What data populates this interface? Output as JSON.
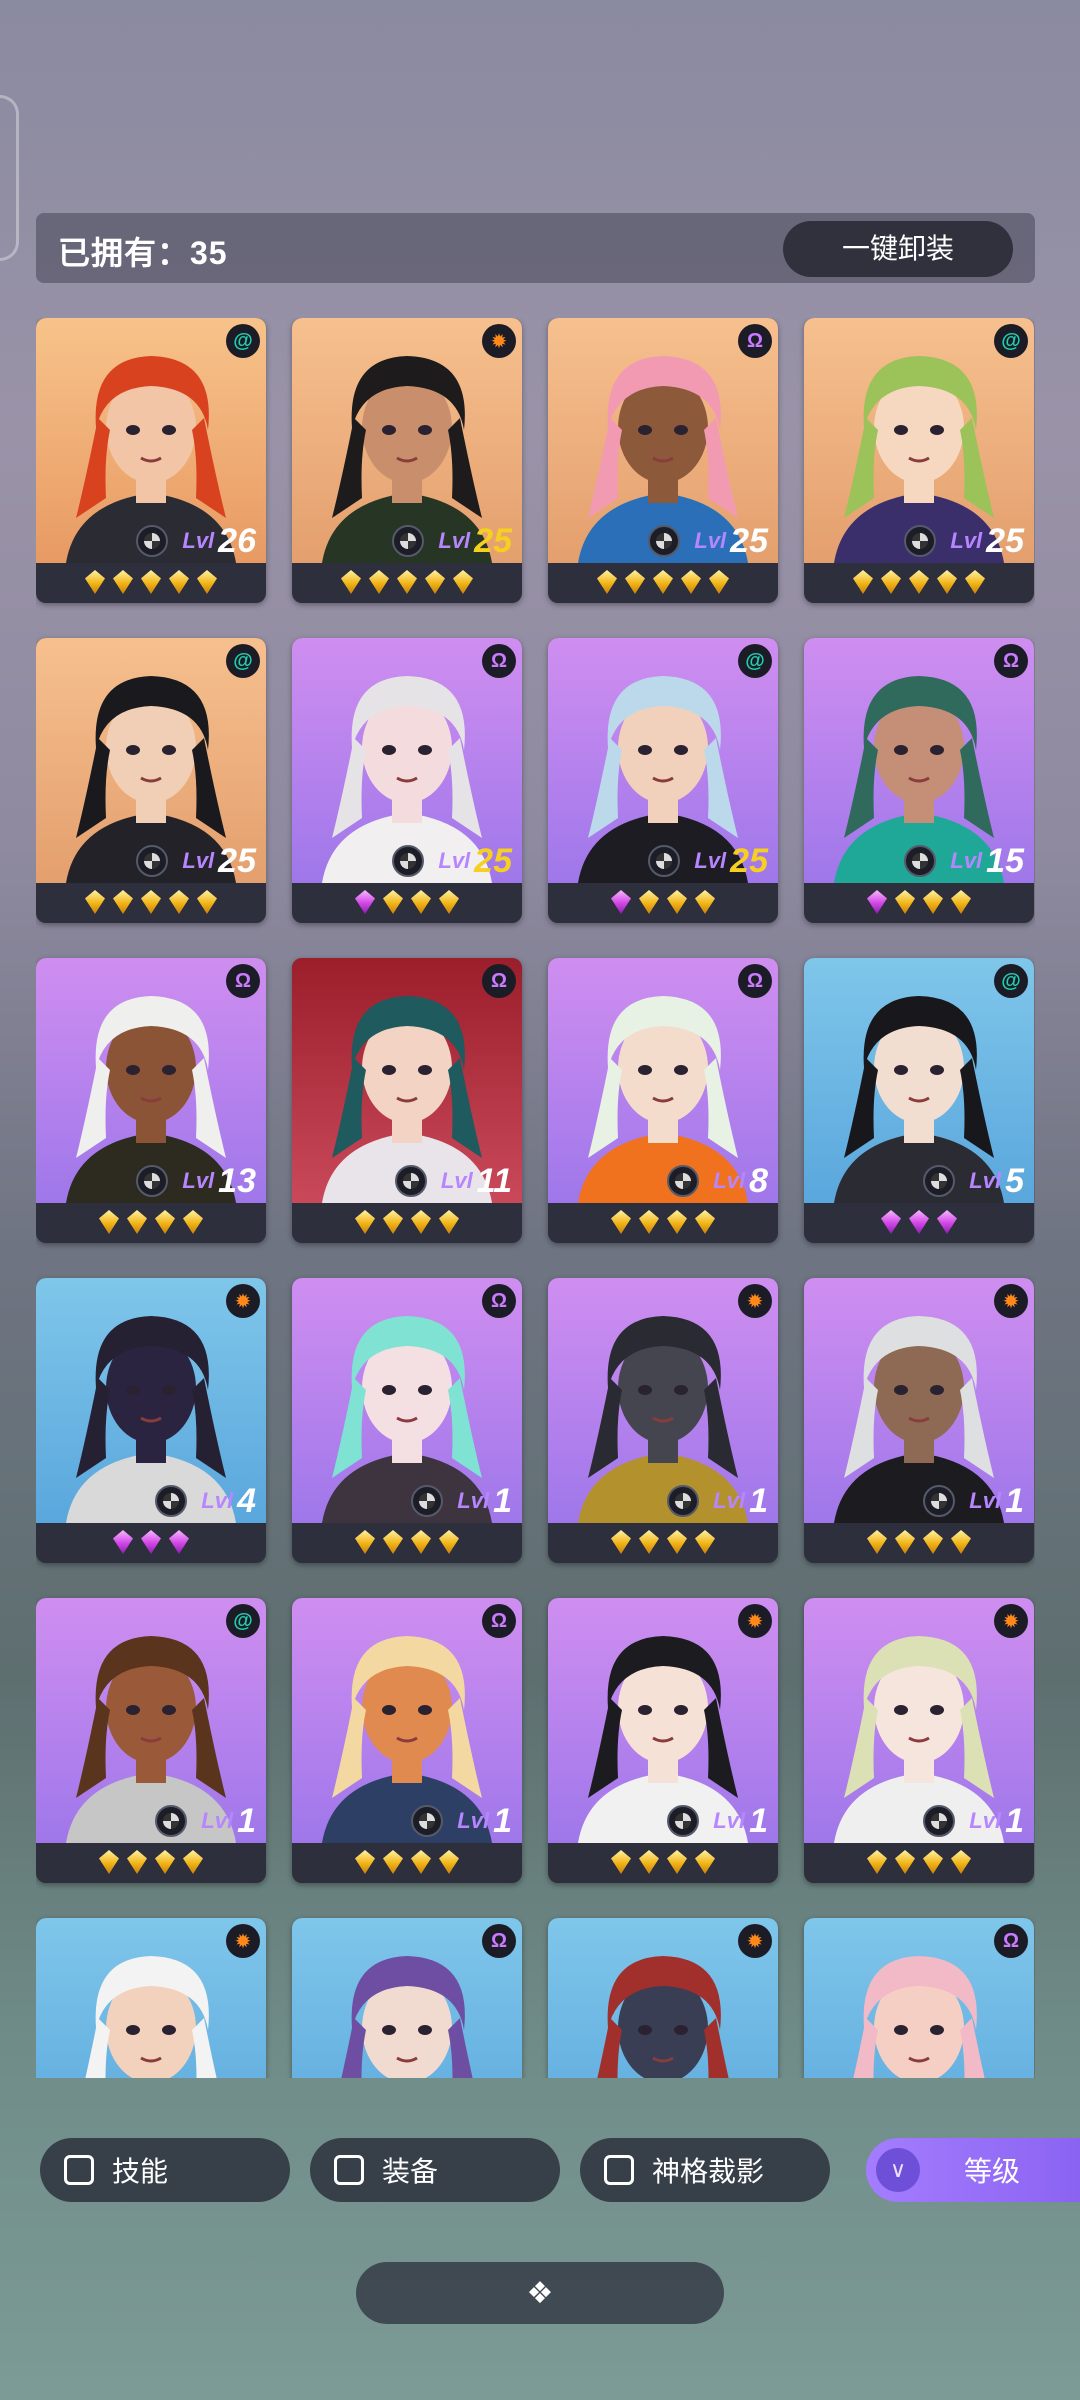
{
  "header": {
    "owned_label": "已拥有：35",
    "unequip_all": "一键卸装"
  },
  "cards": [
    {
      "lvl": "Lvl",
      "level": "26",
      "gold": false,
      "faction": "swirl-icon",
      "gems": [
        "gold",
        "gold",
        "gold",
        "gold",
        "gold"
      ],
      "colors": {
        "bg1": "#f7c38a",
        "bg2": "#e89a63",
        "hair": "#d8421f",
        "skin": "#f1c5a6",
        "cloth": "#2b2b33"
      }
    },
    {
      "lvl": "Lvl",
      "level": "25",
      "gold": true,
      "faction": "gear-icon",
      "gems": [
        "gold",
        "gold",
        "gold",
        "gold",
        "gold"
      ],
      "colors": {
        "bg1": "#f6c08e",
        "bg2": "#e49f6e",
        "hair": "#1e1b1c",
        "skin": "#c98f6c",
        "cloth": "#273525"
      }
    },
    {
      "lvl": "Lvl",
      "level": "25",
      "gold": false,
      "faction": "omega-icon",
      "gems": [
        "gold",
        "gold",
        "gold",
        "gold",
        "gold"
      ],
      "colors": {
        "bg1": "#f6c08e",
        "bg2": "#e49f6e",
        "hair": "#f29ab2",
        "skin": "#8c5a3b",
        "cloth": "#2a6fb8"
      }
    },
    {
      "lvl": "Lvl",
      "level": "25",
      "gold": false,
      "faction": "swirl-icon",
      "gems": [
        "gold",
        "gold",
        "gold",
        "gold",
        "gold"
      ],
      "colors": {
        "bg1": "#f6c08e",
        "bg2": "#e49f6e",
        "hair": "#9cc25a",
        "skin": "#f6d8c0",
        "cloth": "#3b2f6b"
      }
    },
    {
      "lvl": "Lvl",
      "level": "25",
      "gold": false,
      "faction": "swirl-icon",
      "gems": [
        "gold",
        "gold",
        "gold",
        "gold",
        "gold"
      ],
      "colors": {
        "bg1": "#f6c08e",
        "bg2": "#e49f6e",
        "hair": "#1a1a1e",
        "skin": "#f0cfb6",
        "cloth": "#222228"
      }
    },
    {
      "lvl": "Lvl",
      "level": "25",
      "gold": true,
      "faction": "omega-icon",
      "gems": [
        "purple",
        "gold",
        "gold",
        "gold"
      ],
      "colors": {
        "bg1": "#cf8ef0",
        "bg2": "#9f77ea",
        "hair": "#e6e3e6",
        "skin": "#f4dbdd",
        "cloth": "#f1efef"
      }
    },
    {
      "lvl": "Lvl",
      "level": "25",
      "gold": true,
      "faction": "swirl-icon",
      "gems": [
        "purple",
        "gold",
        "gold",
        "gold"
      ],
      "colors": {
        "bg1": "#cf8ef0",
        "bg2": "#9f77ea",
        "hair": "#bcd9ec",
        "skin": "#f1d0bc",
        "cloth": "#1c1c22"
      }
    },
    {
      "lvl": "Lvl",
      "level": "15",
      "gold": false,
      "faction": "omega-icon",
      "gems": [
        "purple",
        "gold",
        "gold",
        "gold"
      ],
      "colors": {
        "bg1": "#cf8ef0",
        "bg2": "#9f77ea",
        "hair": "#2f6a5c",
        "skin": "#c48e77",
        "cloth": "#1fa897"
      }
    },
    {
      "lvl": "Lvl",
      "level": "13",
      "gold": false,
      "faction": "omega-icon",
      "gems": [
        "gold",
        "gold",
        "gold",
        "gold"
      ],
      "colors": {
        "bg1": "#cf8ef0",
        "bg2": "#9f77ea",
        "hair": "#efefee",
        "skin": "#8b5436",
        "cloth": "#2d2a1f"
      }
    },
    {
      "lvl": "Lvl",
      "level": "11",
      "gold": false,
      "faction": "omega-icon",
      "gems": [
        "gold",
        "gold",
        "gold",
        "gold"
      ],
      "colors": {
        "bg1": "#9b1e2b",
        "bg2": "#c9495a",
        "hair": "#1e5a5e",
        "skin": "#f2d3c4",
        "cloth": "#e9e4ea"
      }
    },
    {
      "lvl": "Lvl",
      "level": "8",
      "gold": false,
      "faction": "omega-icon",
      "gems": [
        "gold",
        "gold",
        "gold",
        "gold"
      ],
      "colors": {
        "bg1": "#cf8ef0",
        "bg2": "#9f77ea",
        "hair": "#e7f2e4",
        "skin": "#f3dccc",
        "cloth": "#f0721e"
      }
    },
    {
      "lvl": "Lvl",
      "level": "5",
      "gold": false,
      "faction": "swirl-icon",
      "gems": [
        "purple",
        "purple",
        "purple"
      ],
      "colors": {
        "bg1": "#7fc6ea",
        "bg2": "#5aa7dd",
        "hair": "#18181c",
        "skin": "#f2ddd1",
        "cloth": "#2b2b33"
      }
    },
    {
      "lvl": "Lvl",
      "level": "4",
      "gold": false,
      "faction": "gear-icon",
      "gems": [
        "purple",
        "purple",
        "purple"
      ],
      "colors": {
        "bg1": "#7fc6ea",
        "bg2": "#5aa7dd",
        "hair": "#262033",
        "skin": "#2a2440",
        "cloth": "#d9d9d9"
      }
    },
    {
      "lvl": "Lvl",
      "level": "1",
      "gold": false,
      "faction": "omega-icon",
      "gems": [
        "gold",
        "gold",
        "gold",
        "gold"
      ],
      "colors": {
        "bg1": "#cf8ef0",
        "bg2": "#9f77ea",
        "hair": "#7fe2d2",
        "skin": "#f4dfe2",
        "cloth": "#3d3440"
      }
    },
    {
      "lvl": "Lvl",
      "level": "1",
      "gold": false,
      "faction": "gear-icon",
      "gems": [
        "gold",
        "gold",
        "gold",
        "gold"
      ],
      "colors": {
        "bg1": "#cf8ef0",
        "bg2": "#9f77ea",
        "hair": "#2a2a32",
        "skin": "#45454f",
        "cloth": "#b3922d"
      }
    },
    {
      "lvl": "Lvl",
      "level": "1",
      "gold": false,
      "faction": "gear-icon",
      "gems": [
        "gold",
        "gold",
        "gold",
        "gold"
      ],
      "colors": {
        "bg1": "#cf8ef0",
        "bg2": "#9f77ea",
        "hair": "#dedfe1",
        "skin": "#8e6a55",
        "cloth": "#1b1b20"
      }
    },
    {
      "lvl": "Lvl",
      "level": "1",
      "gold": false,
      "faction": "swirl-icon",
      "gems": [
        "gold",
        "gold",
        "gold",
        "gold"
      ],
      "colors": {
        "bg1": "#cf8ef0",
        "bg2": "#9f77ea",
        "hair": "#5a341d",
        "skin": "#9a5a3a",
        "cloth": "#c6c6c6"
      }
    },
    {
      "lvl": "Lvl",
      "level": "1",
      "gold": false,
      "faction": "omega-icon",
      "gems": [
        "gold",
        "gold",
        "gold",
        "gold"
      ],
      "colors": {
        "bg1": "#cf8ef0",
        "bg2": "#9f77ea",
        "hair": "#f3d9a1",
        "skin": "#e08a4f",
        "cloth": "#2e3f66"
      }
    },
    {
      "lvl": "Lvl",
      "level": "1",
      "gold": false,
      "faction": "gear-icon",
      "gems": [
        "gold",
        "gold",
        "gold",
        "gold"
      ],
      "colors": {
        "bg1": "#cf8ef0",
        "bg2": "#9f77ea",
        "hair": "#1b1b20",
        "skin": "#f6e1d6",
        "cloth": "#f1f1f1"
      }
    },
    {
      "lvl": "Lvl",
      "level": "1",
      "gold": false,
      "faction": "gear-icon",
      "gems": [
        "gold",
        "gold",
        "gold",
        "gold"
      ],
      "colors": {
        "bg1": "#cf8ef0",
        "bg2": "#9f77ea",
        "hair": "#dbe0b5",
        "skin": "#f6e5dc",
        "cloth": "#efefef"
      }
    },
    {
      "lvl": "",
      "level": "",
      "gold": false,
      "faction": "gear-icon",
      "gems": [],
      "colors": {
        "bg1": "#7fc6ea",
        "bg2": "#5aa7dd",
        "hair": "#f3f3f3",
        "skin": "#f3d2bd",
        "cloth": "#f3f3f3"
      }
    },
    {
      "lvl": "",
      "level": "",
      "gold": false,
      "faction": "omega-icon",
      "gems": [],
      "colors": {
        "bg1": "#7fc6ea",
        "bg2": "#5aa7dd",
        "hair": "#6e4ea2",
        "skin": "#f1dad0",
        "cloth": "#a6d83c"
      }
    },
    {
      "lvl": "",
      "level": "",
      "gold": false,
      "faction": "gear-icon",
      "gems": [],
      "colors": {
        "bg1": "#7fc6ea",
        "bg2": "#5aa7dd",
        "hair": "#a12f2b",
        "skin": "#3a3e55",
        "cloth": "#b9352f"
      }
    },
    {
      "lvl": "",
      "level": "",
      "gold": false,
      "faction": "omega-icon",
      "gems": [],
      "colors": {
        "bg1": "#7fc6ea",
        "bg2": "#5aa7dd",
        "hair": "#f2b9c6",
        "skin": "#f6cfc4",
        "cloth": "#e3a24d"
      }
    }
  ],
  "filters": {
    "skill": "技能",
    "equipment": "装备",
    "divinity": "神格裁影",
    "sort": "等级"
  },
  "colors": {
    "accent": "#9a72f6",
    "card_bg": "#2d2f3c",
    "level_gold": "#f5d021"
  }
}
